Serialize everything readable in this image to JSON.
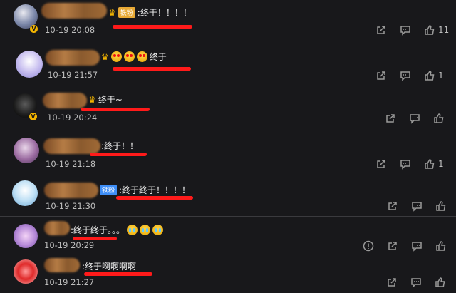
{
  "comments": [
    {
      "text": ":终于！！！！",
      "badge": "铁粉",
      "badge_color": "#e8a935",
      "time": "10-19 20:08",
      "likes": "11",
      "verified": "V"
    },
    {
      "text": "终于",
      "time": "10-19 21:57",
      "likes": "1"
    },
    {
      "text": "终于~",
      "time": "10-19 20:24",
      "verified": "V"
    },
    {
      "text": ":终于！！",
      "time": "10-19 21:18",
      "likes": "1"
    },
    {
      "text": ":终于终于！！！！",
      "badge": "铁粉",
      "badge_color": "#3e8ef7",
      "time": "10-19 21:30"
    },
    {
      "text": ":终于终于。。。",
      "time": "10-19 20:29"
    },
    {
      "text": ":终于啊啊啊啊",
      "time": "10-19 21:27"
    }
  ],
  "icons": {
    "share": "share-icon",
    "reply": "comment-icon",
    "like": "thumbs-up-icon",
    "report": "report-icon"
  },
  "colors": {
    "background": "#18181b",
    "highlight": "#ff1a1a",
    "crown": "#f2b400"
  }
}
